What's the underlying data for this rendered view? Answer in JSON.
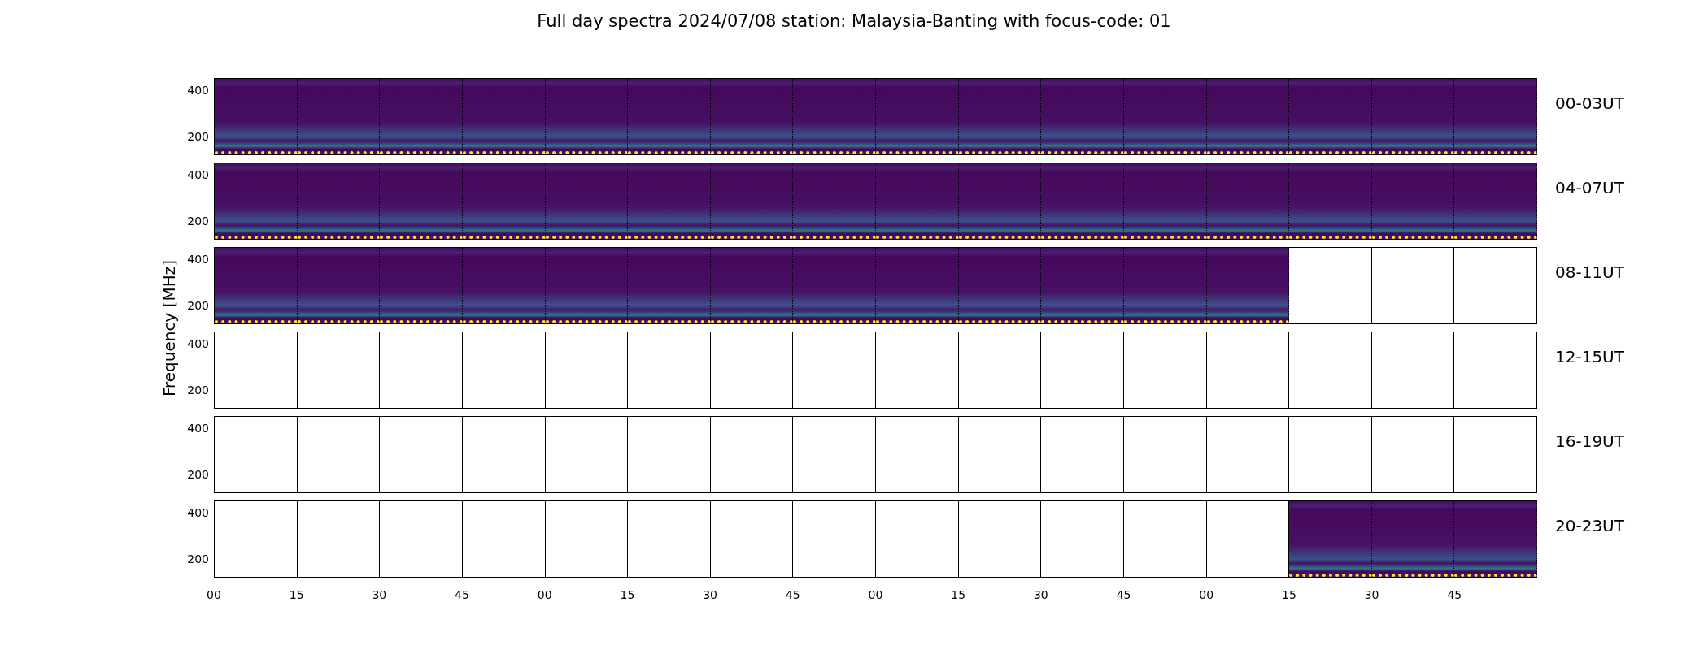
{
  "title": "Full day spectra 2024/07/08 station: Malaysia-Banting with focus-code: 01",
  "y_axis_label": "Frequency [MHz]",
  "rows": [
    {
      "label": "00-03UT",
      "y_ticks": [
        "400",
        "200"
      ],
      "panels": [
        {
          "has_data": true
        },
        {
          "has_data": true
        },
        {
          "has_data": true
        },
        {
          "has_data": true
        },
        {
          "has_data": true
        },
        {
          "has_data": true
        },
        {
          "has_data": true
        },
        {
          "has_data": true
        },
        {
          "has_data": true
        },
        {
          "has_data": true
        },
        {
          "has_data": true
        },
        {
          "has_data": true
        },
        {
          "has_data": true
        },
        {
          "has_data": true
        },
        {
          "has_data": true
        },
        {
          "has_data": true
        }
      ]
    },
    {
      "label": "04-07UT",
      "y_ticks": [
        "400",
        "200"
      ],
      "panels": [
        {
          "has_data": true
        },
        {
          "has_data": true
        },
        {
          "has_data": true
        },
        {
          "has_data": true
        },
        {
          "has_data": true
        },
        {
          "has_data": true
        },
        {
          "has_data": true
        },
        {
          "has_data": true
        },
        {
          "has_data": true
        },
        {
          "has_data": true
        },
        {
          "has_data": true
        },
        {
          "has_data": true
        },
        {
          "has_data": true
        },
        {
          "has_data": true
        },
        {
          "has_data": true
        },
        {
          "has_data": true
        }
      ]
    },
    {
      "label": "08-11UT",
      "y_ticks": [
        "400",
        "200"
      ],
      "panels": [
        {
          "has_data": true
        },
        {
          "has_data": true
        },
        {
          "has_data": true
        },
        {
          "has_data": true
        },
        {
          "has_data": true
        },
        {
          "has_data": true
        },
        {
          "has_data": true
        },
        {
          "has_data": true
        },
        {
          "has_data": true
        },
        {
          "has_data": true
        },
        {
          "has_data": true
        },
        {
          "has_data": true
        },
        {
          "has_data": true
        },
        {
          "has_data": false
        },
        {
          "has_data": false
        },
        {
          "has_data": false
        }
      ]
    },
    {
      "label": "12-15UT",
      "y_ticks": [
        "400",
        "200"
      ],
      "panels": [
        {
          "has_data": false
        },
        {
          "has_data": false
        },
        {
          "has_data": false
        },
        {
          "has_data": false
        },
        {
          "has_data": false
        },
        {
          "has_data": false
        },
        {
          "has_data": false
        },
        {
          "has_data": false
        },
        {
          "has_data": false
        },
        {
          "has_data": false
        },
        {
          "has_data": false
        },
        {
          "has_data": false
        },
        {
          "has_data": false
        },
        {
          "has_data": false
        },
        {
          "has_data": false
        },
        {
          "has_data": false
        }
      ]
    },
    {
      "label": "16-19UT",
      "y_ticks": [
        "400",
        "200"
      ],
      "panels": [
        {
          "has_data": false
        },
        {
          "has_data": false
        },
        {
          "has_data": false
        },
        {
          "has_data": false
        },
        {
          "has_data": false
        },
        {
          "has_data": false
        },
        {
          "has_data": false
        },
        {
          "has_data": false
        },
        {
          "has_data": false
        },
        {
          "has_data": false
        },
        {
          "has_data": false
        },
        {
          "has_data": false
        },
        {
          "has_data": false
        },
        {
          "has_data": false
        },
        {
          "has_data": false
        },
        {
          "has_data": false
        }
      ]
    },
    {
      "label": "20-23UT",
      "y_ticks": [
        "400",
        "200"
      ],
      "panels": [
        {
          "has_data": false
        },
        {
          "has_data": false
        },
        {
          "has_data": false
        },
        {
          "has_data": false
        },
        {
          "has_data": false
        },
        {
          "has_data": false
        },
        {
          "has_data": false
        },
        {
          "has_data": false
        },
        {
          "has_data": false
        },
        {
          "has_data": false
        },
        {
          "has_data": false
        },
        {
          "has_data": false
        },
        {
          "has_data": false
        },
        {
          "has_data": true
        },
        {
          "has_data": true
        },
        {
          "has_data": true
        }
      ]
    }
  ],
  "x_ticks": [
    "00",
    "15",
    "30",
    "45",
    "00",
    "15",
    "30",
    "45",
    "00",
    "15",
    "30",
    "45",
    "00",
    "15",
    "30",
    "45"
  ]
}
